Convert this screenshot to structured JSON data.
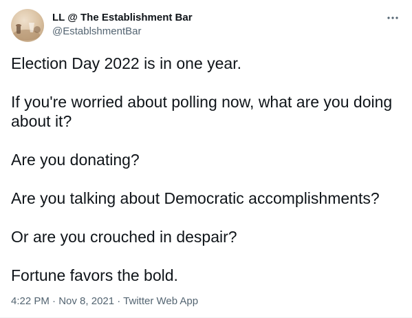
{
  "author": {
    "display_name": "LL @ The Establishment Bar",
    "handle": "@EstablshmentBar"
  },
  "tweet": {
    "paragraphs": [
      "Election Day 2022 is in one year.",
      "If you're worried about polling now, what are you doing about it?",
      "Are you donating?",
      "Are you talking about Democratic accomplishments?",
      "Or are you crouched in despair?",
      "Fortune favors the bold."
    ]
  },
  "meta": {
    "time": "4:22 PM",
    "separator": " · ",
    "date": "Nov 8, 2021",
    "source": "Twitter Web App"
  },
  "icons": {
    "more": "more-horizontal-icon",
    "avatar": "profile-photo"
  },
  "colors": {
    "text_primary": "#0f1419",
    "text_secondary": "#536471"
  }
}
